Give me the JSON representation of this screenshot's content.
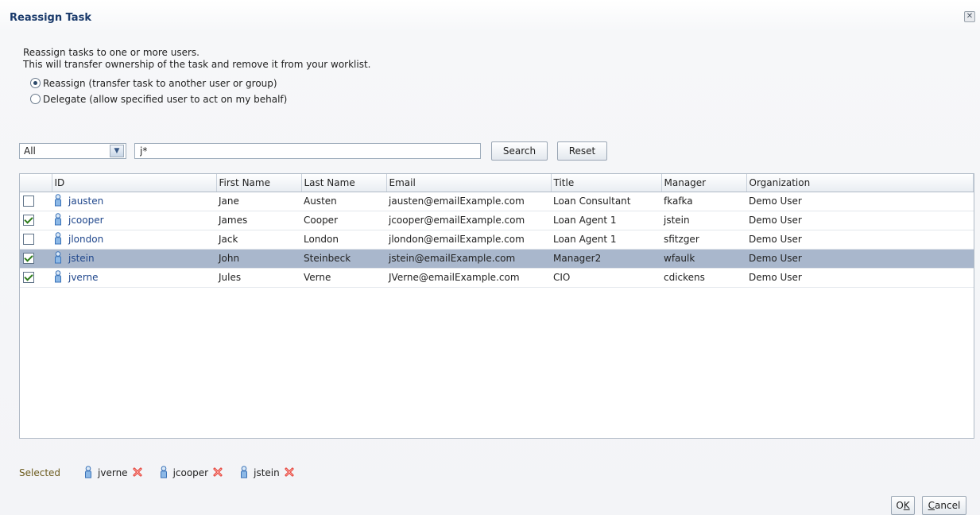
{
  "dialog": {
    "title": "Reassign Task",
    "close_icon": "close-icon"
  },
  "description": {
    "line1": "Reassign tasks to one or more users.",
    "line2": "This will transfer ownership of the task and remove it from your worklist."
  },
  "options": {
    "reassign": {
      "label": "Reassign (transfer task to another user or group)",
      "checked": true
    },
    "delegate": {
      "label": "Delegate (allow specified user to act on my behalf)",
      "checked": false
    }
  },
  "search": {
    "filter_selected": "All",
    "query": "j*",
    "search_label": "Search",
    "reset_label": "Reset"
  },
  "table": {
    "columns": [
      "ID",
      "First Name",
      "Last Name",
      "Email",
      "Title",
      "Manager",
      "Organization"
    ],
    "rows": [
      {
        "checked": false,
        "selected": false,
        "id": "jausten",
        "first": "Jane",
        "last": "Austen",
        "email": "jausten@emailExample.com",
        "title": "Loan Consultant",
        "manager": "fkafka",
        "org": "Demo User"
      },
      {
        "checked": true,
        "selected": false,
        "id": "jcooper",
        "first": "James",
        "last": "Cooper",
        "email": "jcooper@emailExample.com",
        "title": "Loan Agent 1",
        "manager": "jstein",
        "org": "Demo User"
      },
      {
        "checked": false,
        "selected": false,
        "id": "jlondon",
        "first": "Jack",
        "last": "London",
        "email": "jlondon@emailExample.com",
        "title": "Loan Agent 1",
        "manager": "sfitzger",
        "org": "Demo User"
      },
      {
        "checked": true,
        "selected": true,
        "id": "jstein",
        "first": "John",
        "last": "Steinbeck",
        "email": "jstein@emailExample.com",
        "title": "Manager2",
        "manager": "wfaulk",
        "org": "Demo User"
      },
      {
        "checked": true,
        "selected": false,
        "id": "jverne",
        "first": "Jules",
        "last": "Verne",
        "email": "JVerne@emailExample.com",
        "title": "CIO",
        "manager": "cdickens",
        "org": "Demo User"
      }
    ]
  },
  "selected": {
    "label": "Selected",
    "users": [
      "jverne",
      "jcooper",
      "jstein"
    ]
  },
  "footer": {
    "ok_label": "OK",
    "cancel_label": "Cancel"
  },
  "icons": {
    "user": "user-icon",
    "remove": "remove-icon",
    "dropdown": "chevron-down-icon"
  },
  "colors": {
    "selected_row": "#a9b7cc",
    "link": "#20478c",
    "title": "#1a3a6b",
    "remove": "#e2362d"
  }
}
